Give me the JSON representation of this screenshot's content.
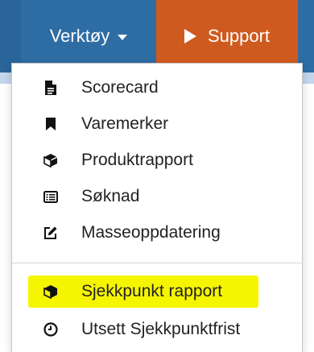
{
  "navbar": {
    "tools_label": "Verktøy",
    "support_label": "Support",
    "colors": {
      "navbar": "#2e6da4",
      "support": "#cf5a1f"
    }
  },
  "menu": {
    "items": [
      {
        "label": "Scorecard",
        "icon": "file-icon"
      },
      {
        "label": "Varemerker",
        "icon": "bookmark-icon"
      },
      {
        "label": "Produktrapport",
        "icon": "cube-icon"
      },
      {
        "label": "Søknad",
        "icon": "list-card-icon"
      },
      {
        "label": "Masseoppdatering",
        "icon": "edit-icon"
      },
      {
        "label": "Sjekkpunkt rapport",
        "icon": "cube-icon",
        "highlighted": true
      },
      {
        "label": "Utsett Sjekkpunktfrist",
        "icon": "clock-icon"
      }
    ],
    "highlight_color": "#f7f700"
  }
}
